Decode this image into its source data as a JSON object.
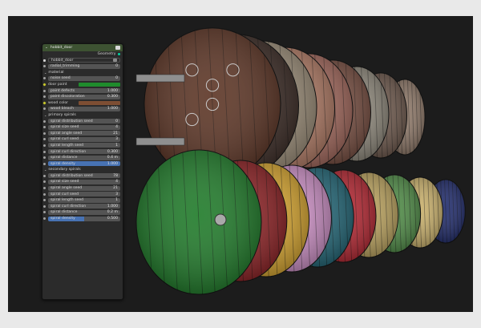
{
  "node": {
    "title": "hobbit_door",
    "header_chevron": "⌄",
    "icon": "node-tree-icon",
    "output_label": "Geometry",
    "datablock": "hobbit_door",
    "rows_top": [
      {
        "label": "radial_trimming",
        "value": "0"
      }
    ],
    "sections": [
      {
        "title": "material",
        "rows": [
          {
            "label": "noise seed",
            "value": "0",
            "kind": "num"
          },
          {
            "label": "door paint",
            "value": "",
            "kind": "color",
            "color": "#1f8b2c"
          },
          {
            "label": "paint defects",
            "value": "1.000",
            "kind": "num"
          },
          {
            "label": "paint discoloration",
            "value": "0.300",
            "kind": "num"
          },
          {
            "label": "wood color",
            "value": "",
            "kind": "color",
            "color": "#7d4e33"
          },
          {
            "label": "wood bleach",
            "value": "1.000",
            "kind": "num"
          }
        ]
      },
      {
        "title": "primary spirals",
        "rows": [
          {
            "label": "spiral distribution seed",
            "value": "0",
            "kind": "num"
          },
          {
            "label": "spiral size seed",
            "value": "4",
            "kind": "num"
          },
          {
            "label": "spiral angle seed",
            "value": "21",
            "kind": "num"
          },
          {
            "label": "spiral curl seed",
            "value": "3",
            "kind": "num"
          },
          {
            "label": "spiral length seed",
            "value": "1",
            "kind": "num"
          },
          {
            "label": "spiral curl direction",
            "value": "0.300",
            "kind": "num"
          },
          {
            "label": "spiral distance",
            "value": "0.4 m",
            "kind": "num"
          },
          {
            "label": "spiral density",
            "value": "1.000",
            "kind": "slider",
            "fill": 1.0
          }
        ]
      },
      {
        "title": "secondary spirals",
        "rows": [
          {
            "label": "spiral distribution seed",
            "value": "78",
            "kind": "num"
          },
          {
            "label": "spiral size seed",
            "value": "4",
            "kind": "num"
          },
          {
            "label": "spiral angle seed",
            "value": "21",
            "kind": "num"
          },
          {
            "label": "spiral curl seed",
            "value": "3",
            "kind": "num"
          },
          {
            "label": "spiral length seed",
            "value": "1",
            "kind": "num"
          },
          {
            "label": "spiral curl direction",
            "value": "1.000",
            "kind": "num"
          },
          {
            "label": "spiral distance",
            "value": "0.2 m",
            "kind": "num"
          },
          {
            "label": "spiral density",
            "value": "0.500",
            "kind": "slider",
            "fill": 0.5
          }
        ]
      }
    ]
  },
  "colors": {
    "node_header": "#3d5232",
    "socket_geometry": "#00d6a3",
    "socket_float": "#a1a1a1",
    "socket_int": "#35875a",
    "socket_color": "#c7c729",
    "slider_fill": "#4772b3"
  },
  "scene": {
    "back_doors": [
      {
        "wood": "#5b3323",
        "ornate": true
      },
      {
        "wood": "#3a2a24",
        "ornate": true
      },
      {
        "wood": "#9a8c77",
        "ornate": true
      },
      {
        "wood": "#b07a64",
        "ornate": true
      },
      {
        "wood": "#a0665a",
        "ornate": true
      },
      {
        "wood": "#744b3e",
        "ornate": true
      },
      {
        "wood": "#8c8679",
        "ornate": true
      },
      {
        "wood": "#6a5549",
        "ornate": true
      },
      {
        "wood": "#8d7767",
        "ornate": true
      }
    ],
    "front_doors": [
      {
        "paint": "#1e7a28"
      },
      {
        "paint": "#8a1f22"
      },
      {
        "paint": "#d3a22d"
      },
      {
        "paint": "#c98dc2"
      },
      {
        "paint": "#1f6272"
      },
      {
        "paint": "#b22530"
      },
      {
        "paint": "#b8a05c"
      },
      {
        "paint": "#4e8a45"
      },
      {
        "paint": "#c9b06b"
      },
      {
        "paint": "#1f2a6a"
      }
    ]
  }
}
